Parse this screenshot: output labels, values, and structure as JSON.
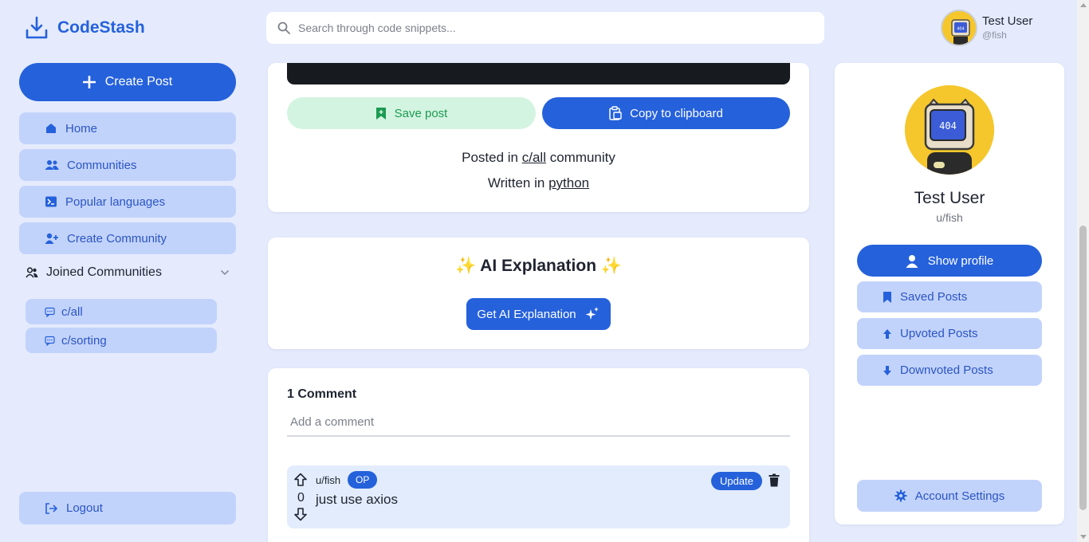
{
  "app": {
    "name": "CodeStash"
  },
  "search": {
    "placeholder": "Search through code snippets..."
  },
  "user": {
    "name": "Test User",
    "handle": "@fish",
    "profile_handle": "u/fish"
  },
  "sidebar": {
    "create_label": "Create Post",
    "items": [
      {
        "label": "Home",
        "icon": "home-icon"
      },
      {
        "label": "Communities",
        "icon": "users-icon"
      },
      {
        "label": "Popular languages",
        "icon": "terminal-icon"
      },
      {
        "label": "Create Community",
        "icon": "user-plus-icon"
      }
    ],
    "joined_label": "Joined Communities",
    "communities": [
      "c/all",
      "c/sorting"
    ],
    "logout_label": "Logout"
  },
  "post": {
    "save_label": "Save post",
    "copy_label": "Copy to clipboard",
    "posted_prefix": "Posted in",
    "community": "c/all",
    "posted_suffix": "community",
    "written_prefix": "Written in",
    "language": "python"
  },
  "ai": {
    "title": "✨ AI Explanation ✨",
    "button_label": "Get AI Explanation"
  },
  "comments": {
    "heading": "1 Comment",
    "placeholder": "Add a comment",
    "items": [
      {
        "author": "u/fish",
        "badge": "OP",
        "votes": "0",
        "text": "just use axios",
        "update_label": "Update"
      }
    ]
  },
  "profile": {
    "show_profile_label": "Show profile",
    "saved_label": "Saved Posts",
    "upvoted_label": "Upvoted Posts",
    "downvoted_label": "Downvoted Posts",
    "settings_label": "Account Settings"
  },
  "colors": {
    "primary": "#2561db",
    "nav_bg": "#c2d3fb",
    "page_bg": "#e5ebfd",
    "save_bg": "#d3f4e0",
    "save_fg": "#1c9a52"
  }
}
